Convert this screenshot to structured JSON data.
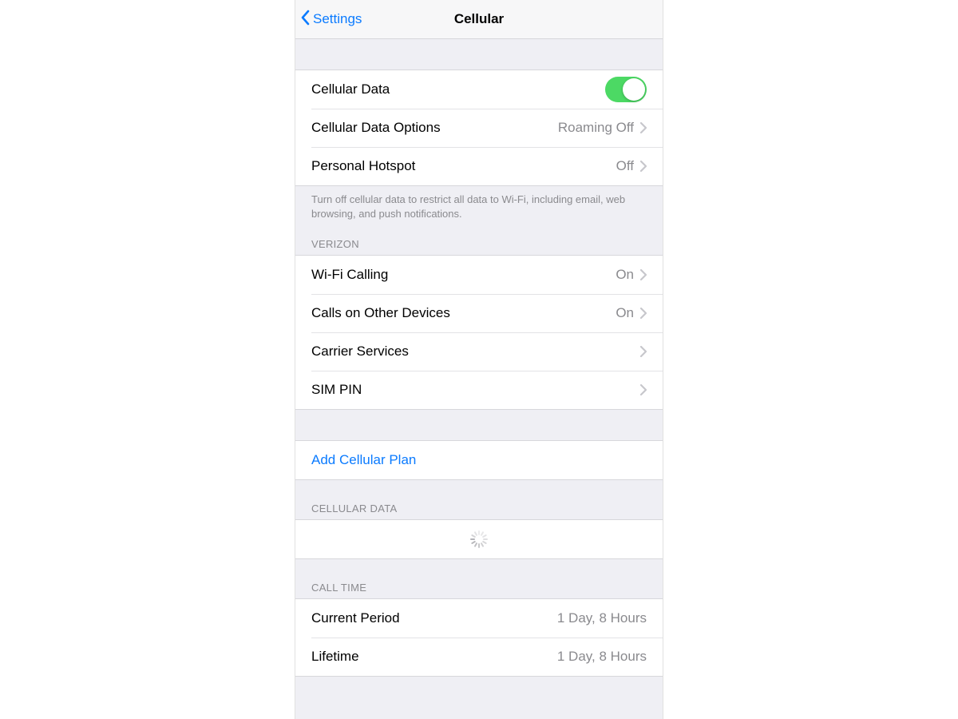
{
  "nav": {
    "back_label": "Settings",
    "title": "Cellular"
  },
  "section1": {
    "cellular_data": {
      "label": "Cellular Data",
      "on": true
    },
    "cellular_data_options": {
      "label": "Cellular Data Options",
      "value": "Roaming Off"
    },
    "personal_hotspot": {
      "label": "Personal Hotspot",
      "value": "Off"
    },
    "footer": "Turn off cellular data to restrict all data to Wi-Fi, including email, web browsing, and push notifications."
  },
  "carrier_section": {
    "header": "VERIZON",
    "wifi_calling": {
      "label": "Wi-Fi Calling",
      "value": "On"
    },
    "calls_other_devices": {
      "label": "Calls on Other Devices",
      "value": "On"
    },
    "carrier_services": {
      "label": "Carrier Services"
    },
    "sim_pin": {
      "label": "SIM PIN"
    }
  },
  "add_plan": {
    "label": "Add Cellular Plan"
  },
  "cellular_data_usage": {
    "header": "CELLULAR DATA"
  },
  "call_time": {
    "header": "CALL TIME",
    "current_period": {
      "label": "Current Period",
      "value": "1 Day, 8 Hours"
    },
    "lifetime": {
      "label": "Lifetime",
      "value": "1 Day, 8 Hours"
    }
  }
}
